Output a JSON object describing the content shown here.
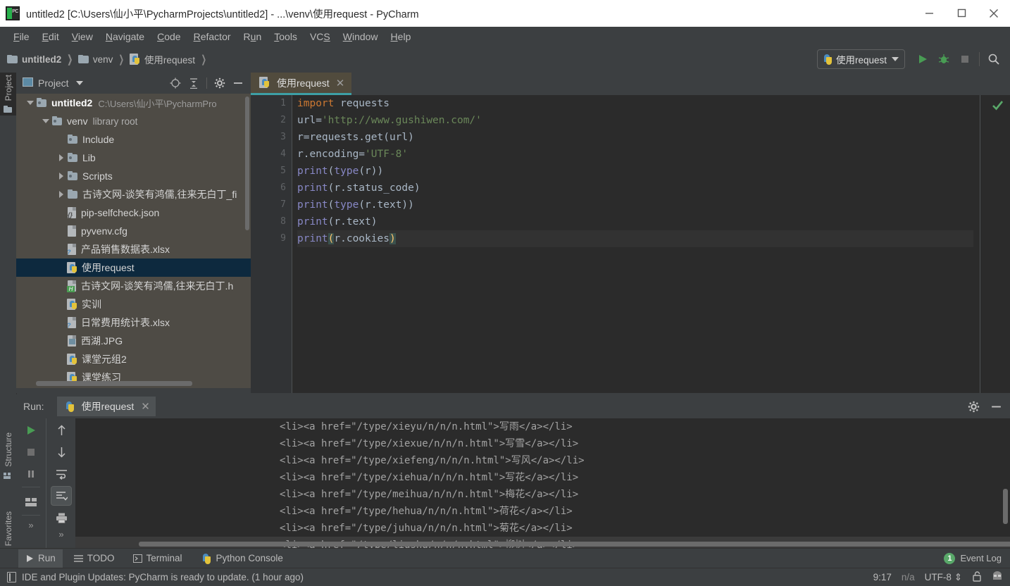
{
  "window": {
    "title": "untitled2 [C:\\Users\\仙小平\\PycharmProjects\\untitled2] - ...\\venv\\使用request - PyCharm",
    "minimize_label": "Minimize",
    "maximize_label": "Maximize",
    "close_label": "Close",
    "app_icon": "pycharm-icon"
  },
  "menubar": {
    "items": [
      "File",
      "Edit",
      "View",
      "Navigate",
      "Code",
      "Refactor",
      "Run",
      "Tools",
      "VCS",
      "Window",
      "Help"
    ]
  },
  "breadcrumb": {
    "items": [
      {
        "label": "untitled2",
        "icon": "folder-icon",
        "bold": true
      },
      {
        "label": "venv",
        "icon": "folder-icon",
        "bold": false
      },
      {
        "label": "使用request",
        "icon": "python-file-icon",
        "bold": false
      }
    ]
  },
  "toolbar": {
    "run_config": "使用request",
    "run_config_icon": "python-icon",
    "dropdown_icon": "chevron-down-icon",
    "run_icon": "run-icon",
    "debug_icon": "debug-icon",
    "stop_icon": "stop-icon",
    "search_icon": "search-icon"
  },
  "left_strip": {
    "tabs": [
      {
        "label": "Project",
        "icon": "project-icon",
        "active": true
      },
      {
        "label": "Structure",
        "icon": "structure-icon",
        "active": false
      },
      {
        "label": "Favorites",
        "icon": "star-icon",
        "active": false
      }
    ]
  },
  "project_panel": {
    "title": "Project",
    "title_icon": "project-icon",
    "dropdown_icon": "chevron-down-icon",
    "locate_icon": "target-icon",
    "collapse_icon": "collapse-all-icon",
    "settings_icon": "gear-icon",
    "hide_icon": "minimize-icon",
    "tree": [
      {
        "name": "untitled2",
        "detail": "C:\\Users\\仙小平\\PycharmPro",
        "indent": 0,
        "arrow": "down",
        "icon": "folder-icon",
        "bold": true,
        "selected": false
      },
      {
        "name": "venv",
        "detail": "library root",
        "indent": 1,
        "arrow": "down",
        "icon": "folder-icon",
        "bold": false,
        "selected": false
      },
      {
        "name": "Include",
        "detail": "",
        "indent": 2,
        "arrow": "none",
        "icon": "folder-icon",
        "bold": false,
        "selected": false
      },
      {
        "name": "Lib",
        "detail": "",
        "indent": 2,
        "arrow": "right",
        "icon": "folder-icon",
        "bold": false,
        "selected": false
      },
      {
        "name": "Scripts",
        "detail": "",
        "indent": 2,
        "arrow": "right",
        "icon": "folder-icon",
        "bold": false,
        "selected": false
      },
      {
        "name": "古诗文网-谈笑有鸿儒,往来无白丁_fi",
        "detail": "",
        "indent": 2,
        "arrow": "right",
        "icon": "folder-plain-icon",
        "bold": false,
        "selected": false
      },
      {
        "name": "pip-selfcheck.json",
        "detail": "",
        "indent": 2,
        "arrow": "none",
        "icon": "json-file-icon",
        "bold": false,
        "selected": false
      },
      {
        "name": "pyvenv.cfg",
        "detail": "",
        "indent": 2,
        "arrow": "none",
        "icon": "config-file-icon",
        "bold": false,
        "selected": false
      },
      {
        "name": "产品销售数据表.xlsx",
        "detail": "",
        "indent": 2,
        "arrow": "none",
        "icon": "unknown-file-icon",
        "bold": false,
        "selected": false
      },
      {
        "name": "使用request",
        "detail": "",
        "indent": 2,
        "arrow": "none",
        "icon": "python-file-icon",
        "bold": false,
        "selected": true
      },
      {
        "name": "古诗文网-谈笑有鸿儒,往来无白丁.h",
        "detail": "",
        "indent": 2,
        "arrow": "none",
        "icon": "html-file-icon",
        "bold": false,
        "selected": false
      },
      {
        "name": "实训",
        "detail": "",
        "indent": 2,
        "arrow": "none",
        "icon": "python-file-icon",
        "bold": false,
        "selected": false
      },
      {
        "name": "日常费用统计表.xlsx",
        "detail": "",
        "indent": 2,
        "arrow": "none",
        "icon": "unknown-file-icon",
        "bold": false,
        "selected": false
      },
      {
        "name": "西湖.JPG",
        "detail": "",
        "indent": 2,
        "arrow": "none",
        "icon": "image-file-icon",
        "bold": false,
        "selected": false
      },
      {
        "name": "课堂元组2",
        "detail": "",
        "indent": 2,
        "arrow": "none",
        "icon": "python-file-icon",
        "bold": false,
        "selected": false
      },
      {
        "name": "课堂练习",
        "detail": "",
        "indent": 2,
        "arrow": "none",
        "icon": "python-file-icon",
        "bold": false,
        "selected": false
      }
    ]
  },
  "editor": {
    "tab": {
      "label": "使用request",
      "icon": "python-file-icon",
      "close_icon": "close-icon"
    },
    "inspection_status_icon": "check-ok-icon",
    "line_numbers": [
      "1",
      "2",
      "3",
      "4",
      "5",
      "6",
      "7",
      "8",
      "9"
    ],
    "lines": [
      "import requests",
      "url='http://www.gushiwen.com/'",
      "r=requests.get(url)",
      "r.encoding='UTF-8'",
      "print(type(r))",
      "print(r.status_code)",
      "print(type(r.text))",
      "print(r.text)",
      "print(r.cookies)"
    ],
    "current_line": 9
  },
  "run_window": {
    "label": "Run:",
    "tab": {
      "label": "使用request",
      "icon": "python-icon",
      "close_icon": "close-icon"
    },
    "settings_icon": "gear-icon",
    "hide_icon": "minimize-icon",
    "toolbar_left": [
      "rerun-icon",
      "stop-icon",
      "pause-icon",
      "layout-icon",
      "expand-icon"
    ],
    "toolbar_right": [
      "up-arrow-icon",
      "down-arrow-icon",
      "soft-wrap-icon",
      "scroll-to-end-icon",
      "print-icon",
      "expand-icon"
    ],
    "console_lines": [
      "<li><a href=\"/type/xieyu/n/n/n.html\">写雨</a></li>",
      "<li><a href=\"/type/xiexue/n/n/n.html\">写雪</a></li>",
      "<li><a href=\"/type/xiefeng/n/n/n.html\">写风</a></li>",
      "<li><a href=\"/type/xiehua/n/n/n.html\">写花</a></li>",
      "<li><a href=\"/type/meihua/n/n/n.html\">梅花</a></li>",
      "<li><a href=\"/type/hehua/n/n/n.html\">荷花</a></li>",
      "<li><a href=\"/type/juhua/n/n/n.html\">菊花</a></li>",
      "<li><a href=\"/type/liushu/n/n/n.html\">柳树</a></li>"
    ]
  },
  "bottom_bar": {
    "buttons": [
      {
        "label": "Run",
        "icon": "run-icon",
        "active": true
      },
      {
        "label": "TODO",
        "icon": "todo-icon",
        "active": false
      },
      {
        "label": "Terminal",
        "icon": "terminal-icon",
        "active": false
      },
      {
        "label": "Python Console",
        "icon": "python-icon",
        "active": false
      }
    ],
    "event_log": {
      "label": "Event Log",
      "count": "1",
      "badge_color": "#59a869"
    }
  },
  "status_bar": {
    "message": "IDE and Plugin Updates: PyCharm is ready to update. (1 hour ago)",
    "message_icon": "update-icon",
    "caret_position": "9:17",
    "line_separator": "n/a",
    "encoding": "UTF-8",
    "encoding_chevron_icon": "chevron-updown-icon",
    "lock_icon": "unlocked-icon",
    "inspector_icon": "hector-icon"
  },
  "colors": {
    "background": "#3c3f41",
    "editor_bg": "#2b2b2b",
    "tree_bg": "#4e4b45",
    "selection": "#0d293e",
    "accent_teal": "#3d9fa5",
    "keyword": "#cc7832",
    "string": "#6a8759",
    "function": "#8888c6",
    "text": "#a9b7c6",
    "green": "#59a869"
  }
}
